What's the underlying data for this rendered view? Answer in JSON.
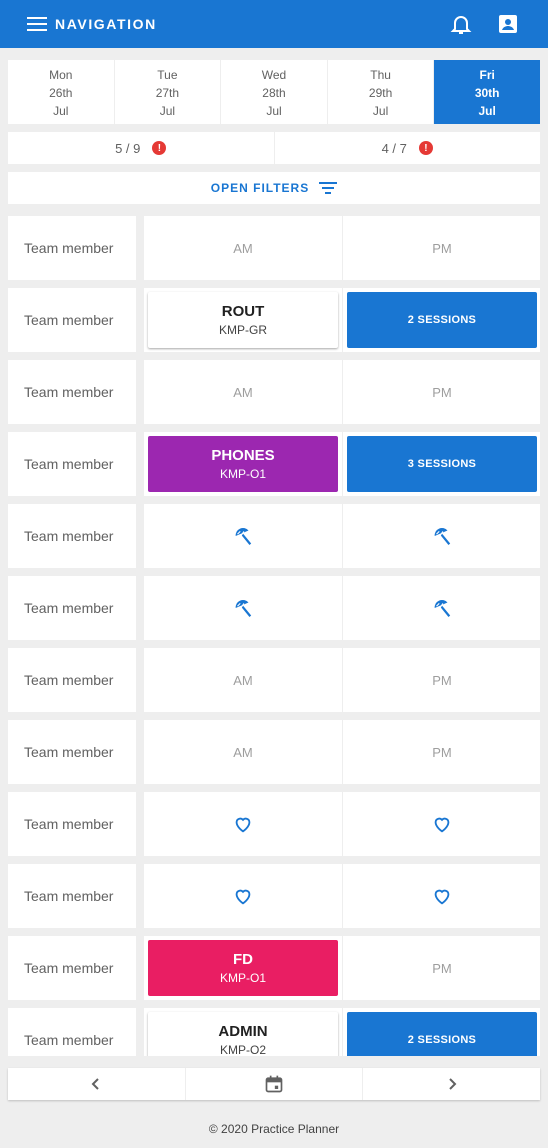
{
  "header": {
    "title": "NAVIGATION",
    "icons": [
      "menu-icon",
      "bell-icon",
      "account-box-icon"
    ]
  },
  "days": [
    {
      "dow": "Mon",
      "date": "26th",
      "month": "Jul"
    },
    {
      "dow": "Tue",
      "date": "27th",
      "month": "Jul"
    },
    {
      "dow": "Wed",
      "date": "28th",
      "month": "Jul"
    },
    {
      "dow": "Thu",
      "date": "29th",
      "month": "Jul"
    },
    {
      "dow": "Fri",
      "date": "30th",
      "month": "Jul"
    }
  ],
  "counts": {
    "am": "5 / 9",
    "pm": "4 / 7",
    "alert": "!"
  },
  "filters": {
    "label": "OPEN FILTERS"
  },
  "rows": [
    {
      "label": "Team member",
      "am": "AM",
      "pm": "PM"
    },
    {
      "label": "Team member",
      "am_title": "ROUT",
      "am_sub": "KMP-GR",
      "pm": "2 SESSIONS"
    },
    {
      "label": "Team member",
      "am": "AM",
      "pm": "PM"
    },
    {
      "label": "Team member",
      "am_title": "PHONES",
      "am_sub": "KMP-O1",
      "pm": "3 SESSIONS"
    },
    {
      "label": "Team member",
      "am_icon": "beach-umbrella-icon",
      "pm_icon": "beach-umbrella-icon"
    },
    {
      "label": "Team member",
      "am_icon": "beach-umbrella-icon",
      "pm_icon": "beach-umbrella-icon"
    },
    {
      "label": "Team member",
      "am": "AM",
      "pm": "PM"
    },
    {
      "label": "Team member",
      "am": "AM",
      "pm": "PM"
    },
    {
      "label": "Team member",
      "am_icon": "heart-icon",
      "pm_icon": "heart-icon"
    },
    {
      "label": "Team member",
      "am_icon": "heart-icon",
      "pm_icon": "heart-icon"
    },
    {
      "label": "Team member",
      "am_title": "FD",
      "am_sub": "KMP-O1",
      "pm": "PM"
    },
    {
      "label": "Team member",
      "am_title": "ADMIN",
      "am_sub": "KMP-O2",
      "pm": "2 SESSIONS"
    }
  ],
  "bottom_nav": {
    "icons": [
      "chevron-left-icon",
      "calendar-icon",
      "chevron-right-icon"
    ]
  },
  "footer": {
    "text": "© 2020 Practice Planner"
  },
  "colors": {
    "primary": "#1976d2",
    "purple": "#9c27b0",
    "pink": "#e91e63",
    "alert": "#e53935"
  }
}
